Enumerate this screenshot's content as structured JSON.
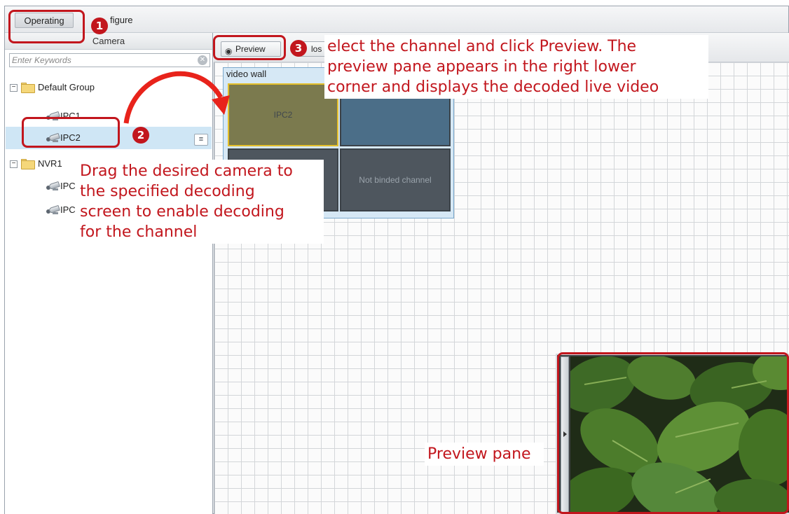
{
  "topbar": {
    "tab_operating": "Operating",
    "tab_configure": "figure"
  },
  "left_panel": {
    "header": "Camera",
    "search_placeholder": "Enter Keywords",
    "tree": [
      {
        "label": "Default Group",
        "type": "group",
        "expanded": true
      },
      {
        "label": "IPC1",
        "type": "camera"
      },
      {
        "label": "IPC2",
        "type": "camera",
        "selected": true
      },
      {
        "label": "NVR1",
        "type": "group",
        "expanded": true
      },
      {
        "label": "IPC",
        "type": "camera"
      },
      {
        "label": "IPC",
        "type": "camera"
      }
    ]
  },
  "toolbar": {
    "preview_label": "Preview",
    "close_label": "los"
  },
  "wall": {
    "title": "video wall",
    "screens": [
      {
        "label": "IPC2",
        "color": "#7b7a4e",
        "highlight": true
      },
      {
        "label": "",
        "color": "#4b6e88"
      },
      {
        "label": "",
        "color": "#4e565e"
      },
      {
        "label": "Not binded channel",
        "color": "#4e565e"
      }
    ]
  },
  "annotations": {
    "step1": "1",
    "step2": "2",
    "step3": "3",
    "callout_drag": [
      "Drag the desired camera to",
      "the specified decoding",
      "screen to enable decoding",
      "for the channel"
    ],
    "callout_preview": [
      "elect the channel and click Preview. The",
      "preview pane appears in the right lower",
      "corner and displays the decoded live video"
    ],
    "callout_pane": "Preview pane",
    "accent_color": "#c2161d"
  }
}
